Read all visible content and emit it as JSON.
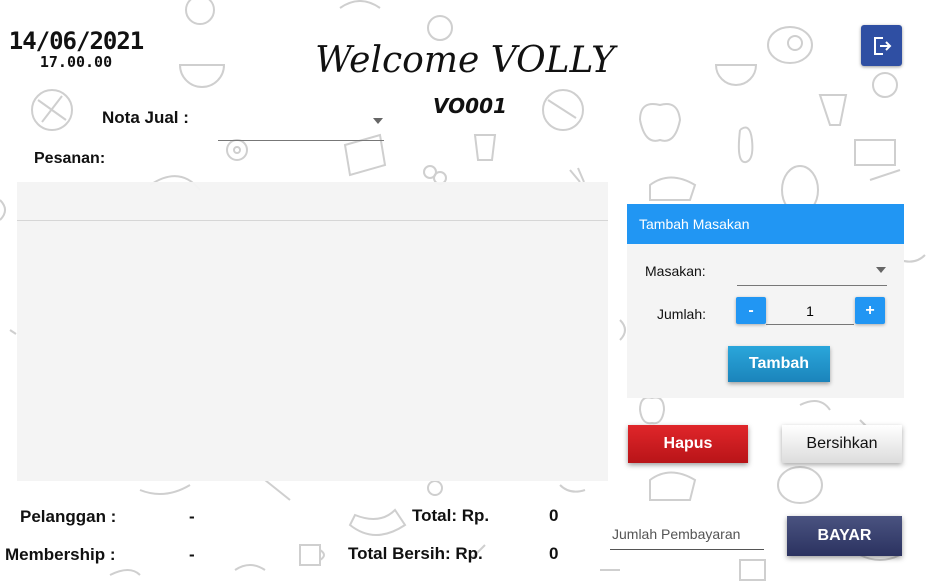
{
  "datetime": {
    "date": "14/06/2021",
    "time": "17.00.00"
  },
  "header": {
    "title": "Welcome VOLLY",
    "code": "VO001",
    "logout_icon": "logout-icon"
  },
  "nota": {
    "label": "Nota Jual :",
    "value": ""
  },
  "pesanan": {
    "label": "Pesanan:"
  },
  "panel": {
    "title": "Tambah Masakan",
    "masakan_label": "Masakan:",
    "masakan_value": "",
    "jumlah_label": "Jumlah:",
    "minus_label": "-",
    "plus_label": "+",
    "quantity": "1",
    "add_label": "Tambah"
  },
  "actions": {
    "delete_label": "Hapus",
    "clear_label": "Bersihkan"
  },
  "footer": {
    "customer_label": "Pelanggan :",
    "customer_value": "-",
    "membership_label": "Membership :",
    "membership_value": "-",
    "total_label": "Total: Rp.",
    "total_value": "0",
    "net_total_label": "Total Bersih: Rp.",
    "net_total_value": "0"
  },
  "payment": {
    "placeholder": "Jumlah Pembayaran",
    "pay_label": "BAYAR"
  },
  "colors": {
    "primary": "#2196f3",
    "danger": "#d01c20",
    "dark_button": "#3a4170",
    "logout": "#2f4fa3"
  }
}
